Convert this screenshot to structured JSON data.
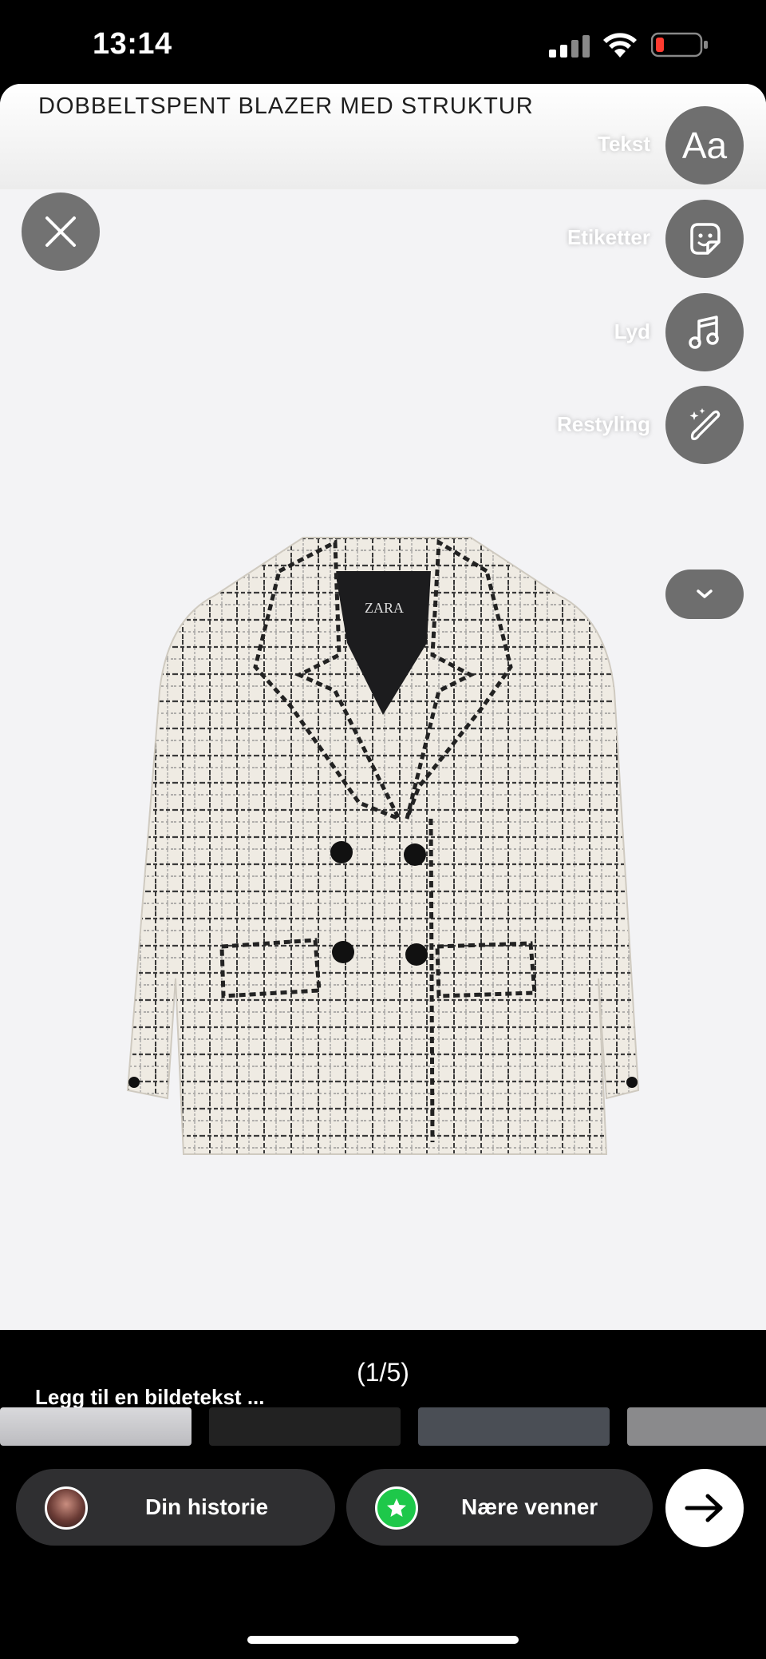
{
  "status_bar": {
    "time": "13:14",
    "signal_icon": "cellular-signal-icon",
    "wifi_icon": "wifi-icon",
    "battery_icon": "battery-low-icon",
    "battery_color": "#ff3b30"
  },
  "story": {
    "product_title": "DOBBELTSPENT BLAZER MED STRUKTUR",
    "brand_label": "ZARA",
    "close_icon": "close-icon",
    "tools": [
      {
        "label": "Tekst",
        "icon": "text-aa-icon",
        "glyph": "Aa"
      },
      {
        "label": "Etiketter",
        "icon": "sticker-icon"
      },
      {
        "label": "Lyd",
        "icon": "music-note-icon"
      },
      {
        "label": "Restyling",
        "icon": "magic-brush-icon"
      }
    ],
    "more_icon": "chevron-down-icon",
    "canvas_color": "#f3f3f5"
  },
  "gallery": {
    "counter": "(1/5)",
    "caption_placeholder": "Legg til en bildetekst ..."
  },
  "share": {
    "your_story_label": "Din historie",
    "close_friends_label": "Nære venner",
    "close_friends_color": "#1ec84a",
    "send_icon": "arrow-right-icon"
  }
}
